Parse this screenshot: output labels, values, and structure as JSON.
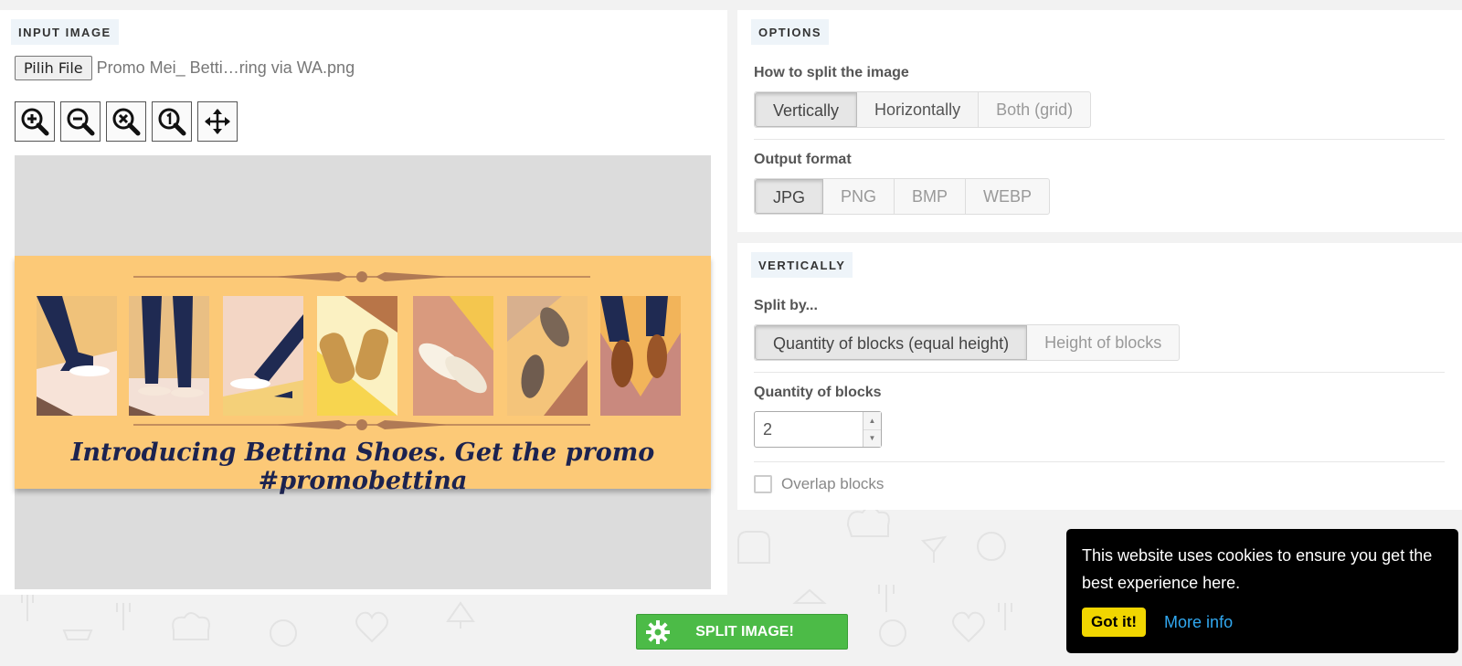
{
  "input_section": {
    "tag": "INPUT IMAGE",
    "file_button_label": "Pilih File",
    "file_name": "Promo Mei_ Betti…ring via WA.png",
    "zoom_tools": [
      "zoom-in-icon",
      "zoom-out-icon",
      "zoom-reset-icon",
      "zoom-actual-size-icon",
      "move-icon"
    ],
    "preview": {
      "banner_caption": "Introducing Bettina Shoes. Get the promo #promobettina",
      "banner_color": "#fcc977"
    }
  },
  "options_section": {
    "tag": "OPTIONS",
    "split_label": "How to split the image",
    "split_options": [
      "Vertically",
      "Horizontally",
      "Both (grid)"
    ],
    "split_selected": "Vertically",
    "format_label": "Output format",
    "format_options": [
      "JPG",
      "PNG",
      "BMP",
      "WEBP"
    ],
    "format_selected": "JPG"
  },
  "vertical_section": {
    "tag": "VERTICALLY",
    "split_by_label": "Split by...",
    "split_by_options": [
      "Quantity of blocks (equal height)",
      "Height of blocks"
    ],
    "split_by_selected": "Quantity of blocks (equal height)",
    "quantity_label": "Quantity of blocks",
    "quantity_value": "2",
    "overlap_label": "Overlap blocks",
    "overlap_checked": false
  },
  "actions": {
    "split_button_label": "SPLIT IMAGE!",
    "split_button_icon": "gear-icon",
    "split_button_color": "#4cbb47"
  },
  "cookie_banner": {
    "message": "This website uses cookies to ensure you get the best experience here.",
    "accept_label": "Got it!",
    "more_info_label": "More info",
    "accept_color": "#f1d600",
    "link_color": "#31a8f0"
  }
}
